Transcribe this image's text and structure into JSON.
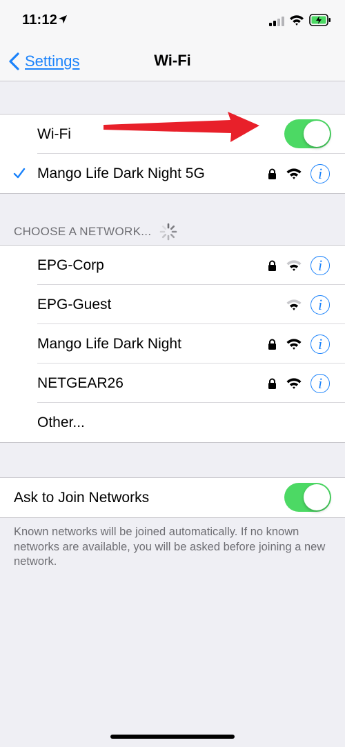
{
  "status": {
    "time": "11:12"
  },
  "nav": {
    "back_label": "Settings",
    "title": "Wi-Fi"
  },
  "wifi": {
    "label": "Wi-Fi",
    "enabled": true
  },
  "connected": {
    "name": "Mango Life Dark Night 5G",
    "secured": true
  },
  "choose_header": "CHOOSE A NETWORK...",
  "networks": [
    {
      "name": "EPG-Corp",
      "secured": true
    },
    {
      "name": "EPG-Guest",
      "secured": false
    },
    {
      "name": "Mango Life Dark Night",
      "secured": true
    },
    {
      "name": "NETGEAR26",
      "secured": true
    }
  ],
  "other_label": "Other...",
  "ask_to_join": {
    "label": "Ask to Join Networks",
    "enabled": true
  },
  "footer_note": "Known networks will be joined automatically. If no known networks are available, you will be asked before joining a new network.",
  "colors": {
    "accent": "#1a82fb",
    "toggle_on": "#4cd964",
    "background": "#efeff4",
    "arrow": "#e8202a"
  }
}
